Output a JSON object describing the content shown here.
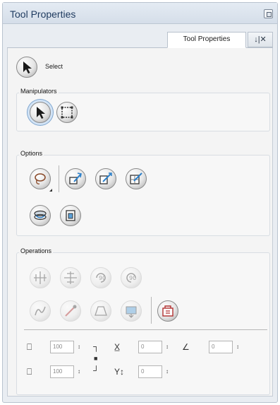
{
  "window": {
    "title": "Tool Properties"
  },
  "tabs": [
    {
      "label": "Tool Properties"
    }
  ],
  "tab_tools_glyph": "↓|✕",
  "select": {
    "label": "Select"
  },
  "groups": {
    "manipulators": {
      "label": "Manipulators"
    },
    "options": {
      "label": "Options"
    },
    "operations": {
      "label": "Operations"
    }
  },
  "params": {
    "width": {
      "value": "100"
    },
    "height": {
      "value": "100"
    },
    "x": {
      "value": "0"
    },
    "y": {
      "value": "0"
    },
    "angle": {
      "value": "0"
    }
  },
  "spin_glyph": "↕",
  "glyphs": {
    "bracket_top": "┐",
    "bracket_bottom": "┘",
    "lock": "■",
    "x_axis": "X̲",
    "y_axis": "Y↕",
    "angle": "∠"
  }
}
